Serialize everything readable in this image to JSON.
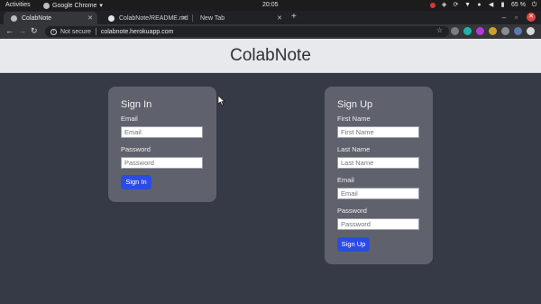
{
  "system_bar": {
    "activities": "Activities",
    "app_name": "Google Chrome",
    "clock": "20:05",
    "battery": "65 %"
  },
  "tabs": [
    {
      "label": "ColabNote"
    },
    {
      "label": "ColabNote/README.md"
    },
    {
      "label": "New Tab"
    }
  ],
  "toolbar": {
    "security": "Not secure",
    "url": "colabnote.herokuapp.com"
  },
  "page": {
    "title": "ColabNote"
  },
  "signin": {
    "title": "Sign In",
    "email_label": "Email",
    "email_placeholder": "Email",
    "password_label": "Password",
    "password_placeholder": "Password",
    "button": "Sign In"
  },
  "signup": {
    "title": "Sign Up",
    "first_name_label": "First Name",
    "first_name_placeholder": "First Name",
    "last_name_label": "Last Name",
    "last_name_placeholder": "Last Name",
    "email_label": "Email",
    "email_placeholder": "Email",
    "password_label": "Password",
    "password_placeholder": "Password",
    "button": "Sign Up"
  },
  "colors": {
    "background": "#363a46",
    "card": "#5f626d",
    "header": "#e8e9ec",
    "accent": "#2b4ce3"
  }
}
